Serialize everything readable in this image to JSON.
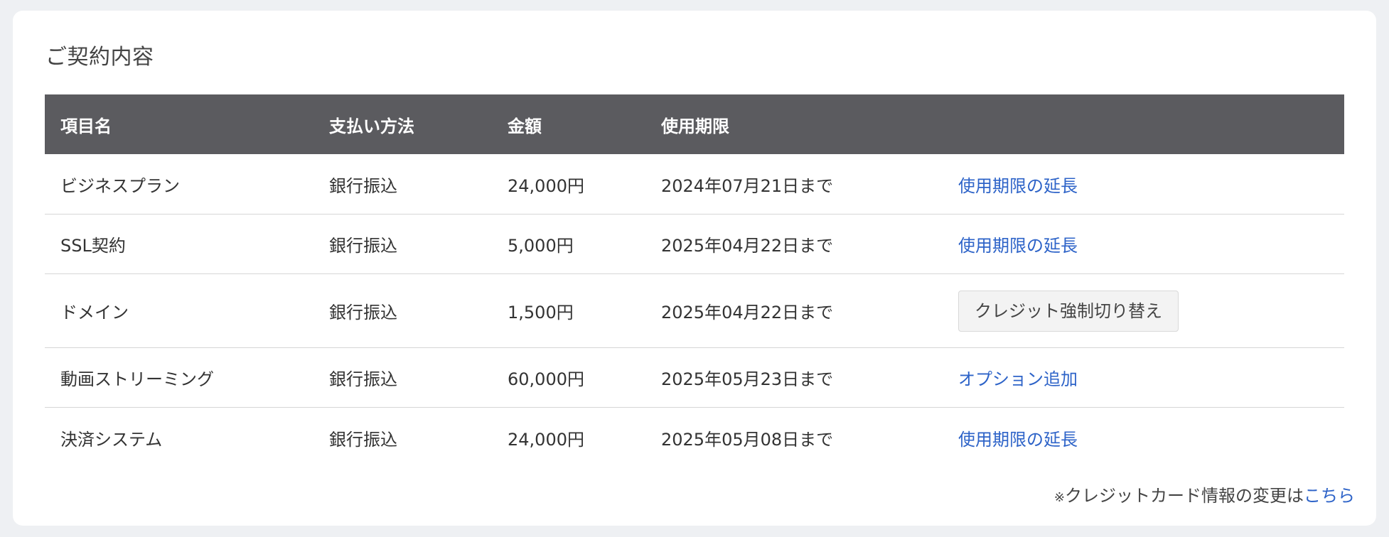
{
  "section_title": "ご契約内容",
  "table": {
    "headers": {
      "item": "項目名",
      "payment": "支払い方法",
      "amount": "金額",
      "expiry": "使用期限",
      "action": ""
    },
    "rows": [
      {
        "item": "ビジネスプラン",
        "payment": "銀行振込",
        "amount": "24,000円",
        "expiry": "2024年07月21日まで",
        "action": "使用期限の延長",
        "action_type": "link"
      },
      {
        "item": "SSL契約",
        "payment": "銀行振込",
        "amount": "5,000円",
        "expiry": "2025年04月22日まで",
        "action": "使用期限の延長",
        "action_type": "link"
      },
      {
        "item": "ドメイン",
        "payment": "銀行振込",
        "amount": "1,500円",
        "expiry": "2025年04月22日まで",
        "action": "クレジット強制切り替え",
        "action_type": "button"
      },
      {
        "item": "動画ストリーミング",
        "payment": "銀行振込",
        "amount": "60,000円",
        "expiry": "2025年05月23日まで",
        "action": "オプション追加",
        "action_type": "link"
      },
      {
        "item": "決済システム",
        "payment": "銀行振込",
        "amount": "24,000円",
        "expiry": "2025年05月08日まで",
        "action": "使用期限の延長",
        "action_type": "link"
      }
    ]
  },
  "footer": {
    "mark": "※",
    "text": "クレジットカード情報の変更は",
    "link": "こちら"
  },
  "colors": {
    "header_bg": "#5b5b5f",
    "link": "#2d63c8",
    "page_bg": "#eef0f3"
  }
}
